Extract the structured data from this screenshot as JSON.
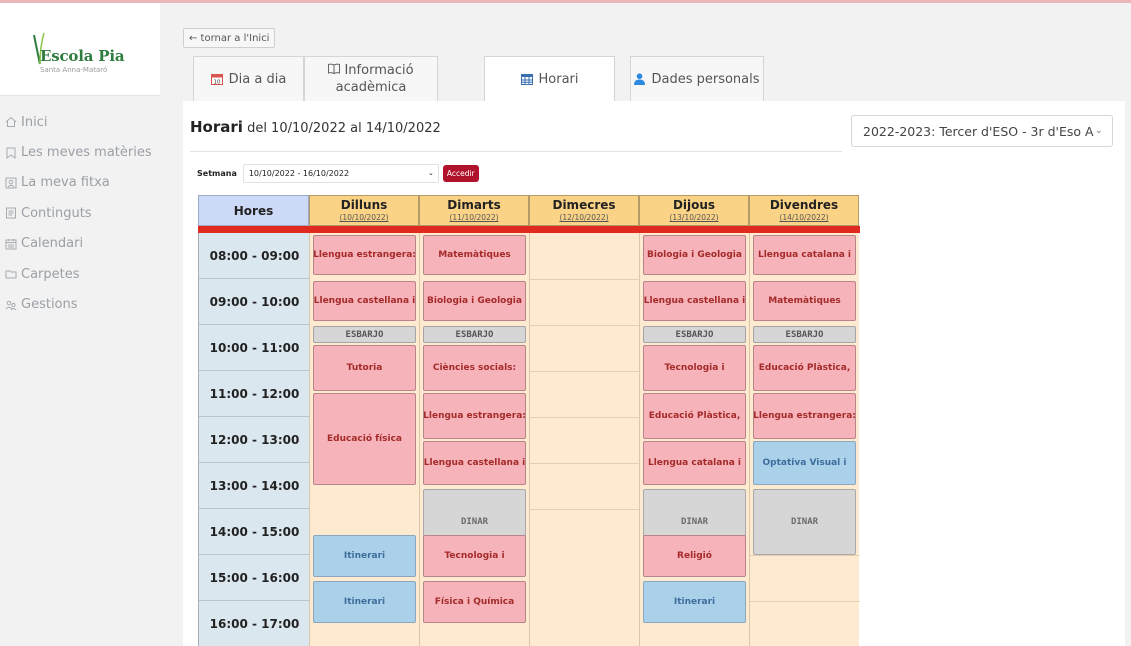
{
  "brand": {
    "name": "Escola Pia",
    "subtitle": "Santa Anna-Mataró",
    "color": "#2f7d3f"
  },
  "sidebar": {
    "items": [
      {
        "label": "Inici",
        "icon": "home-icon"
      },
      {
        "label": "Les meves matèries",
        "icon": "bookmark-icon"
      },
      {
        "label": "La meva fitxa",
        "icon": "id-card-icon"
      },
      {
        "label": "Continguts",
        "icon": "document-icon"
      },
      {
        "label": "Calendari",
        "icon": "calendar-icon"
      },
      {
        "label": "Carpetes",
        "icon": "folder-icon"
      },
      {
        "label": "Gestions",
        "icon": "people-icon"
      }
    ]
  },
  "back_link": "← tornar a l'Inici",
  "tabs": [
    {
      "label": "Dia a dia",
      "icon": "calendar-day-icon"
    },
    {
      "label": "Informació acadèmica",
      "icon": "book-icon"
    },
    {
      "label": "Horari",
      "icon": "table-icon",
      "active": true
    },
    {
      "label": "Dades personals",
      "icon": "user-icon"
    }
  ],
  "title": {
    "bold": "Horari",
    "range": "del 10/10/2022 al 14/10/2022"
  },
  "course_select": {
    "value": "2022-2023: Tercer d'ESO - 3r d'Eso A"
  },
  "week": {
    "label": "Setmana",
    "value": "10/10/2022 - 16/10/2022",
    "button": "Accedir"
  },
  "timetable": {
    "hours_header": "Hores",
    "hours": [
      "08:00 - 09:00",
      "09:00 - 10:00",
      "10:00 - 11:00",
      "11:00 - 12:00",
      "12:00 - 13:00",
      "13:00 - 14:00",
      "14:00 - 15:00",
      "15:00 - 16:00",
      "16:00 - 17:00"
    ],
    "days": [
      {
        "name": "Dilluns",
        "date": "(10/10/2022)"
      },
      {
        "name": "Dimarts",
        "date": "(11/10/2022)"
      },
      {
        "name": "Dimecres",
        "date": "(12/10/2022)"
      },
      {
        "name": "Dijous",
        "date": "(13/10/2022)"
      },
      {
        "name": "Divendres",
        "date": "(14/10/2022)"
      }
    ],
    "break_label": "ESBARJO",
    "lunch_label": "DINAR",
    "classes": {
      "mon": [
        "Llengua estrangera:",
        "Llengua castellana i",
        "Tutoria",
        "Educació física",
        "Itinerari",
        "Itinerari"
      ],
      "tue": [
        "Matemàtiques",
        "Biologia i Geologia",
        "Ciències socials:",
        "Llengua estrangera:",
        "Llengua castellana i",
        "Tecnologia i",
        "Física i Química"
      ],
      "thu": [
        "Biologia i Geologia",
        "Llengua castellana i",
        "Tecnologia i",
        "Educació Plàstica,",
        "Llengua catalana i",
        "Religió",
        "Itinerari"
      ],
      "fri": [
        "Llengua catalana i",
        "Matemàtiques",
        "Educació Plàstica,",
        "Llengua estrangera:",
        "Optativa Visual i"
      ]
    }
  },
  "colors": {
    "subject": "#f6b3b9",
    "optional": "#abd0ea",
    "break": "#d6d6d6",
    "header_day": "#fbd386",
    "header_hours": "#ccd9f7",
    "accent_red": "#e02a1f",
    "button": "#b0122b"
  }
}
